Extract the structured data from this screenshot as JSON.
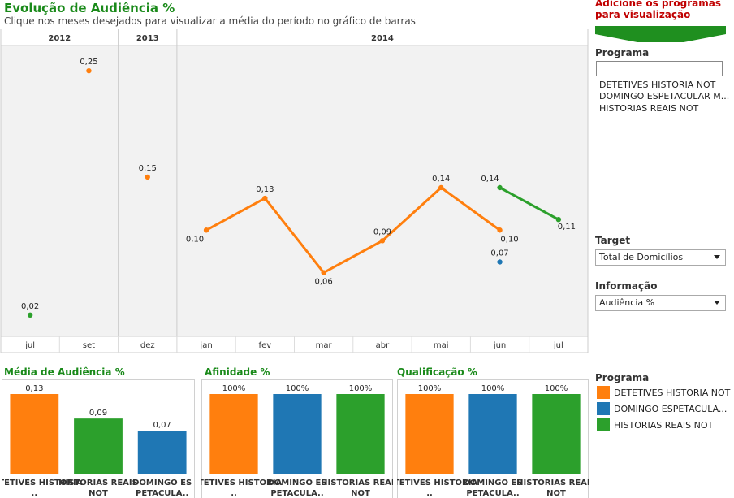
{
  "header": {
    "title": "Evolução de Audiência %",
    "subtitle": "Clique nos meses desejados para visualizar a média do período no gráfico de barras"
  },
  "side_panel": {
    "add_title": "Adicione os programas para visualização",
    "programa_label": "Programa",
    "programa_input_value": "",
    "programa_options": [
      "DETETIVES HISTORIA NOT",
      "DOMINGO ESPETACULAR M...",
      "HISTORIAS REAIS NOT"
    ],
    "target_label": "Target",
    "target_value": "Total de Domicílios",
    "informacao_label": "Informação",
    "informacao_value": "Audiência %",
    "legend_title": "Programa",
    "legend": [
      {
        "label": "DETETIVES HISTORIA NOT",
        "color": "#ff7f0e"
      },
      {
        "label": "DOMINGO ESPETACULA...",
        "color": "#1f77b4"
      },
      {
        "label": "HISTORIAS REAIS NOT",
        "color": "#2ca02c"
      }
    ]
  },
  "colors": {
    "orange": "#ff7f0e",
    "blue": "#1f77b4",
    "green": "#2ca02c",
    "title_green": "#1a8a1a",
    "title_red": "#c00000"
  },
  "chart_data": [
    {
      "type": "line",
      "title": "Evolução de Audiência %",
      "years": [
        {
          "label": "2012",
          "months": [
            "jul",
            "set"
          ]
        },
        {
          "label": "2013",
          "months": [
            "dez"
          ]
        },
        {
          "label": "2014",
          "months": [
            "jan",
            "fev",
            "mar",
            "abr",
            "mai",
            "jun",
            "jul"
          ]
        }
      ],
      "ylim": [
        0,
        0.27
      ],
      "grid": false,
      "series": [
        {
          "color": "#ff7f0e",
          "points": [
            {
              "month_index": 1,
              "value": 0.25,
              "label": "0,25",
              "connected": false
            },
            {
              "month_index": 2,
              "value": 0.15,
              "label": "0,15",
              "connected": false
            },
            {
              "month_index": 3,
              "value": 0.1,
              "label": "0,10",
              "connected": true
            },
            {
              "month_index": 4,
              "value": 0.13,
              "label": "0,13",
              "connected": true
            },
            {
              "month_index": 5,
              "value": 0.06,
              "label": "0,06",
              "connected": true
            },
            {
              "month_index": 6,
              "value": 0.09,
              "label": "0,09",
              "connected": true
            },
            {
              "month_index": 7,
              "value": 0.14,
              "label": "0,14",
              "connected": true
            },
            {
              "month_index": 8,
              "value": 0.1,
              "label": "0,10",
              "connected": true
            }
          ]
        },
        {
          "color": "#1f77b4",
          "points": [
            {
              "month_index": 8,
              "value": 0.07,
              "label": "0,07",
              "connected": false
            }
          ]
        },
        {
          "color": "#2ca02c",
          "points": [
            {
              "month_index": 0,
              "value": 0.02,
              "label": "0,02",
              "connected": false
            },
            {
              "month_index": 8,
              "value": 0.14,
              "label": "0,14",
              "connected": true
            },
            {
              "month_index": 9,
              "value": 0.11,
              "label": "0,11",
              "connected": true
            }
          ]
        }
      ]
    },
    {
      "type": "bar",
      "title": "Média de Audiência %",
      "categories": [
        "DETETIVES HISTORIA ..",
        "HISTORIAS REAIS NOT",
        "DOMINGO ES PETACULA.."
      ],
      "values": [
        0.13,
        0.09,
        0.07
      ],
      "labels": [
        "0,13",
        "0,09",
        "0,07"
      ],
      "colors": [
        "#ff7f0e",
        "#2ca02c",
        "#1f77b4"
      ],
      "ylim": [
        0,
        0.13
      ]
    },
    {
      "type": "bar",
      "title": "Afinidade %",
      "categories": [
        "DETETIVES HISTORIA ..",
        "DOMINGO ES PETACULA..",
        "HISTORIAS REAIS NOT"
      ],
      "values": [
        100,
        100,
        100
      ],
      "labels": [
        "100%",
        "100%",
        "100%"
      ],
      "colors": [
        "#ff7f0e",
        "#1f77b4",
        "#2ca02c"
      ],
      "ylim": [
        0,
        100
      ]
    },
    {
      "type": "bar",
      "title": "Qualificação %",
      "categories": [
        "DETETIVES HISTORIA ..",
        "DOMINGO ES PETACULA..",
        "HISTORIAS REAIS NOT"
      ],
      "values": [
        100,
        100,
        100
      ],
      "labels": [
        "100%",
        "100%",
        "100%"
      ],
      "colors": [
        "#ff7f0e",
        "#1f77b4",
        "#2ca02c"
      ],
      "ylim": [
        0,
        100
      ]
    }
  ]
}
